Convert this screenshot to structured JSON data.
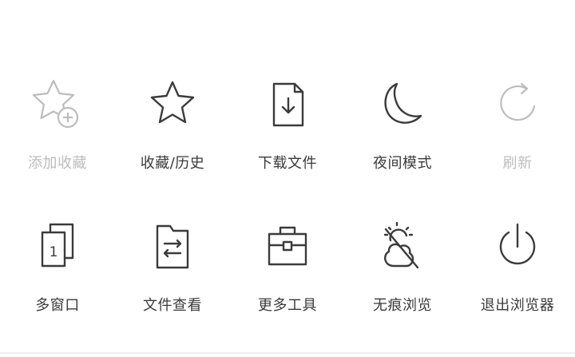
{
  "menu": {
    "items": [
      {
        "label": "添加收藏",
        "icon": "star-add-icon",
        "enabled": false
      },
      {
        "label": "收藏/历史",
        "icon": "star-icon",
        "enabled": true
      },
      {
        "label": "下载文件",
        "icon": "download-file-icon",
        "enabled": true
      },
      {
        "label": "夜间模式",
        "icon": "moon-icon",
        "enabled": true
      },
      {
        "label": "刷新",
        "icon": "refresh-icon",
        "enabled": false
      },
      {
        "label": "多窗口",
        "icon": "multi-window-icon",
        "enabled": true
      },
      {
        "label": "文件查看",
        "icon": "file-view-icon",
        "enabled": true
      },
      {
        "label": "更多工具",
        "icon": "toolbox-icon",
        "enabled": true
      },
      {
        "label": "无痕浏览",
        "icon": "incognito-icon",
        "enabled": true
      },
      {
        "label": "退出浏览器",
        "icon": "power-icon",
        "enabled": true
      }
    ],
    "window_badge": "1"
  },
  "colors": {
    "icon_active": "#3b3b3b",
    "icon_disabled": "#bdbdbd",
    "label_active": "#3a3a3a",
    "label_disabled": "#bdbdbd"
  }
}
